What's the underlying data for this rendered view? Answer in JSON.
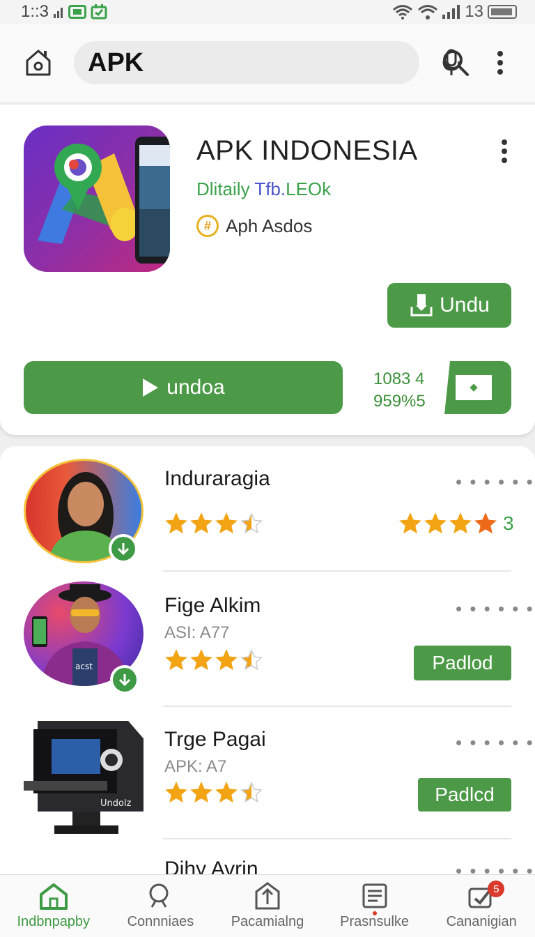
{
  "status_bar": {
    "time": "1::3",
    "right_text": "13",
    "left_icons": [
      "signal-bars-icon",
      "screen-record-icon",
      "calendar-check-icon"
    ],
    "right_icons": [
      "wifi-icon",
      "wifi-icon",
      "signal-bars-icon",
      "battery-icon"
    ]
  },
  "search": {
    "value": "APK"
  },
  "featured": {
    "title": "APK INDONESIA",
    "subtitle_green": "Dlitaily ",
    "subtitle_blue": "Tfb.",
    "subtitle_green_2": "LEOk",
    "developer_badge": "#",
    "developer": "Aph Asdos",
    "undu_label": "Undu",
    "play_label": "undoa",
    "stat_1": "1083 4",
    "stat_2": "959%5",
    "icon_colors": {
      "bg_start": "#6a2fc4",
      "bg_end": "#c02a7f"
    }
  },
  "list": {
    "items": [
      {
        "title": "Induraragia",
        "subtitle": "",
        "rating": 3.5,
        "right_rating": 4,
        "right_number": "3",
        "action": ""
      },
      {
        "title": "Fige Alkim",
        "subtitle": "ASI: A77",
        "rating": 3.5,
        "action": "Padlod",
        "avatar_text": "acst"
      },
      {
        "title": "Trge Pagai",
        "subtitle": "APK: A7",
        "rating": 3.5,
        "action": "Padlcd",
        "avatar_text": "Undolz"
      },
      {
        "title": "Dihy Avrin"
      }
    ]
  },
  "bottom_nav": {
    "items": [
      {
        "label": "Indbnpapby",
        "icon": "home-icon",
        "active": true
      },
      {
        "label": "Connniaes",
        "icon": "search-icon"
      },
      {
        "label": "Pacamialng",
        "icon": "upload-box-icon"
      },
      {
        "label": "Prasnsulke",
        "icon": "document-list-icon"
      },
      {
        "label": "Cananigian",
        "icon": "edit-check-icon",
        "badge": "5"
      }
    ]
  },
  "colors": {
    "accent": "#4c9a47",
    "accent_text": "#3aa24a",
    "link_blue": "#4a54c8",
    "star": "#f2a414",
    "badge_red": "#d93a2b"
  }
}
